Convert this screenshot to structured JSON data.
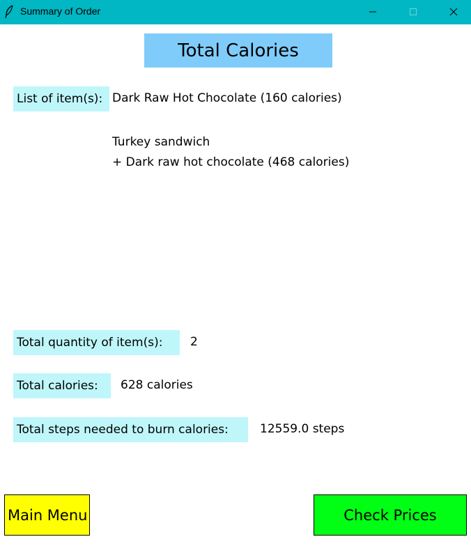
{
  "window": {
    "title": "Summary of Order",
    "icon": "feather-icon"
  },
  "heading": "Total Calories",
  "items": {
    "label": "List of item(s):",
    "entries": [
      "Dark Raw Hot Chocolate  (160 calories)",
      "Turkey sandwich",
      "+ Dark raw hot chocolate  (468 calories)"
    ]
  },
  "summary": {
    "quantity_label": "Total quantity of item(s):",
    "quantity_value": "2",
    "calories_label": "Total calories:",
    "calories_value": "628 calories",
    "steps_label": "Total steps needed to burn calories:",
    "steps_value": "12559.0 steps"
  },
  "buttons": {
    "main_menu": "Main Menu",
    "check_prices": "Check Prices"
  },
  "colors": {
    "titlebar": "#00b7c3",
    "heading_bg": "#7fccfb",
    "label_bg": "#bff6fa",
    "main_menu_bg": "#ffff00",
    "check_prices_bg": "#00ff14"
  }
}
